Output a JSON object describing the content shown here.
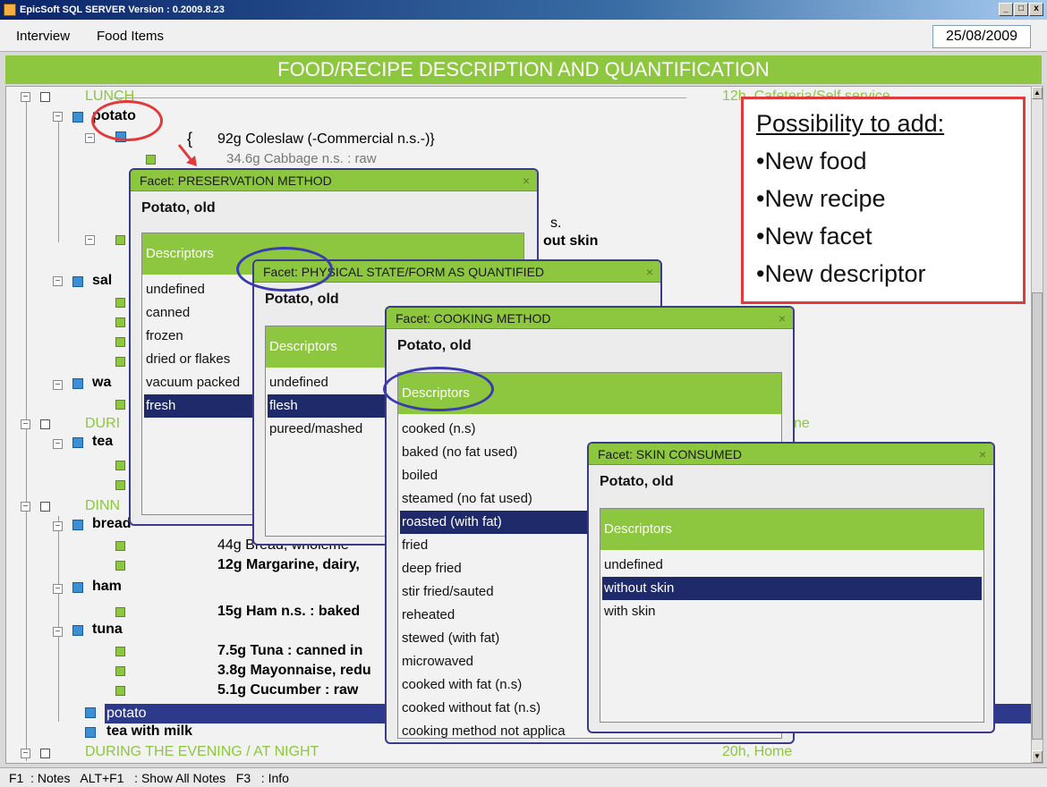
{
  "window": {
    "title": "EpicSoft SQL SERVER Version : 0.2009.8.23",
    "minimize": "_",
    "maximize": "□",
    "close": "x"
  },
  "menu": {
    "interview": "Interview",
    "food_items": "Food Items"
  },
  "date": "25/08/2009",
  "banner": "FOOD/RECIPE DESCRIPTION AND QUANTIFICATION",
  "tree": {
    "lunch": "LUNCH",
    "lunch_meta": "12h, Cafeteria/Self service",
    "potato_top": "potato",
    "brace": "{",
    "coleslaw": "92g Coleslaw (-Commercial n.s.-)}",
    "cabbage": "34.6g Cabbage n.s. : raw",
    "partial_s": "s.",
    "without_skin_tail": "out skin",
    "sal": "sal",
    "wa": "wa",
    "during_day": "DURI",
    "home_tail": "ne",
    "tea": "tea",
    "dinner": "DINN",
    "bread": "bread",
    "bread_item": "44g Bread, wholeme",
    "margarine": "12g Margarine, dairy,",
    "ham": "ham",
    "ham_item": "15g Ham n.s. : baked",
    "tuna": "tuna",
    "tuna_item1": "7.5g Tuna : canned in",
    "tuna_item2": "3.8g Mayonnaise, redu",
    "tuna_item3": "5.1g Cucumber : raw",
    "potato_sel": "potato",
    "tea_milk": "tea with milk",
    "evening": "DURING THE EVENING / AT NIGHT",
    "evening_meta": "20h, Home"
  },
  "facets": {
    "preservation": {
      "title": "Facet: PRESERVATION METHOD",
      "close": "×",
      "food": "Potato, old",
      "descriptors_label": "Descriptors",
      "items": [
        "undefined",
        "canned",
        "frozen",
        "dried or flakes",
        "vacuum packed",
        "fresh"
      ],
      "selected": 5
    },
    "physical": {
      "title": "Facet: PHYSICAL STATE/FORM AS QUANTIFIED",
      "close": "×",
      "food": "Potato, old",
      "descriptors_label": "Descriptors",
      "items": [
        "undefined",
        "flesh",
        "pureed/mashed"
      ],
      "selected": 1
    },
    "cooking": {
      "title": "Facet: COOKING METHOD",
      "close": "×",
      "food": "Potato, old",
      "descriptors_label": "Descriptors",
      "items": [
        "cooked (n.s)",
        "baked (no fat used)",
        "boiled",
        "steamed (no fat used)",
        "roasted (with fat)",
        "fried",
        "deep fried",
        "stir fried/sauted",
        "reheated",
        "stewed (with fat)",
        "microwaved",
        "cooked with fat (n.s)",
        "cooked without fat (n.s)",
        "cooking method not applica"
      ],
      "selected": 4
    },
    "skin": {
      "title": "Facet: SKIN CONSUMED",
      "close": "×",
      "food": "Potato, old",
      "descriptors_label": "Descriptors",
      "items": [
        "undefined",
        "without skin",
        "with skin"
      ],
      "selected": 1
    }
  },
  "note": {
    "title": "Possibility to add:",
    "items": [
      "•New food",
      "•New recipe",
      "•New facet",
      "•New descriptor"
    ]
  },
  "statusbar": "F1  : Notes   ALT+F1   : Show All Notes   F3   : Info",
  "colors": {
    "accent_green": "#8dc63f",
    "selection": "#1f2a6a",
    "highlight_red": "#e03a3a",
    "highlight_blue": "#3b3bb0"
  }
}
